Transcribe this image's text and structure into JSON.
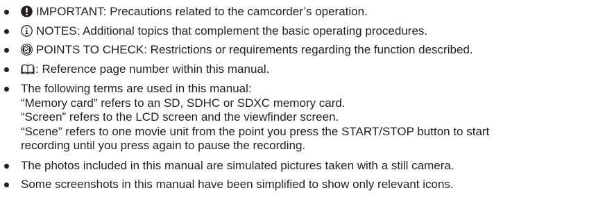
{
  "items": [
    {
      "icon": "important-icon",
      "text": "IMPORTANT: Precautions related to the camcorder’s operation."
    },
    {
      "icon": "notes-icon",
      "text": "NOTES: Additional topics that complement the basic operating procedures."
    },
    {
      "icon": "points-to-check-icon",
      "text": "POINTS TO CHECK: Restrictions or requirements regarding the function described."
    },
    {
      "icon": "reference-page-icon",
      "text": ": Reference page number within this manual."
    }
  ],
  "terms": {
    "intro": "The following terms are used in this manual:",
    "lines": [
      "“Memory card” refers to an SD, SDHC or SDXC memory card.",
      "“Screen” refers to the LCD screen and the viewfinder screen.",
      "“Scene” refers to one movie unit from the point you press the START/STOP button to start",
      "recording until you press again to pause the recording."
    ]
  },
  "notes_after": [
    "The photos included in this manual are simulated pictures taken with a still camera.",
    "Some screenshots in this manual have been simplified to show only relevant icons."
  ]
}
